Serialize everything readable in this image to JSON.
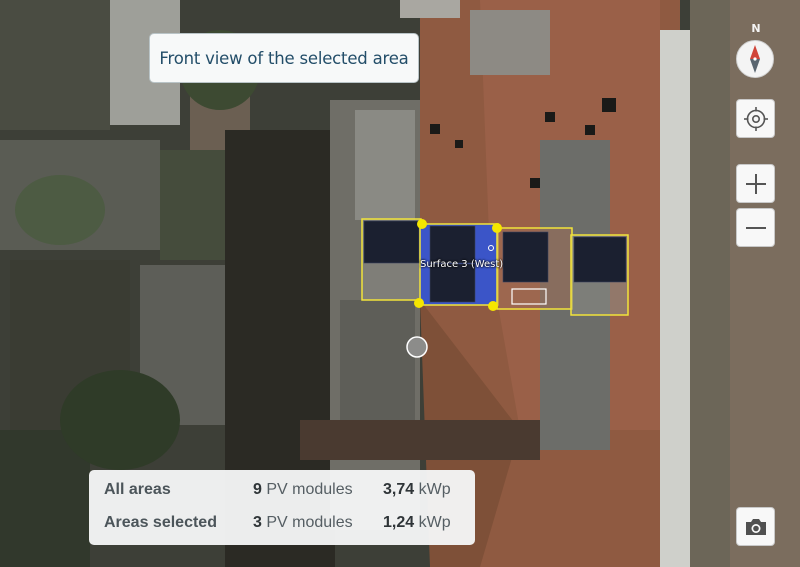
{
  "toolbar": {
    "front_view_label": "Front view of the selected area"
  },
  "map_controls": {
    "compass_north": "N",
    "icons": [
      "compass-icon",
      "locate-icon",
      "zoom-in-icon",
      "zoom-out-icon",
      "camera-icon"
    ]
  },
  "surface": {
    "label": "Surface 3 (West)"
  },
  "summary": {
    "rows": [
      {
        "label": "All areas",
        "modules_count": "9",
        "modules_unit": "PV modules",
        "power_value": "3,74",
        "power_unit": "kWp"
      },
      {
        "label": "Areas selected",
        "modules_count": "3",
        "modules_unit": "PV modules",
        "power_value": "1,24",
        "power_unit": "kWp"
      }
    ]
  },
  "colors": {
    "selection_outline": "#f2e43a",
    "vertex_handle": "#f5e600",
    "selected_panel": "#3b55c8",
    "panel": "#1b2030",
    "button_text": "#234e69"
  }
}
